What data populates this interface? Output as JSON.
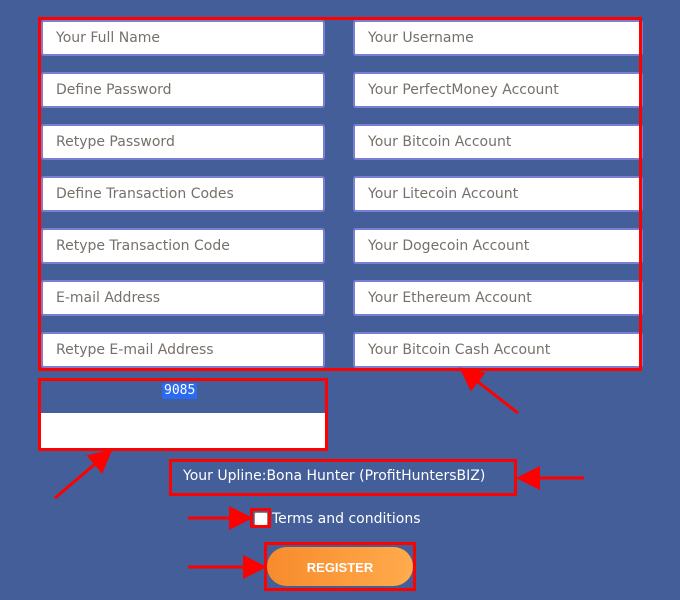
{
  "form": {
    "left_fields": [
      {
        "placeholder": "Your Full Name"
      },
      {
        "placeholder": "Define Password"
      },
      {
        "placeholder": "Retype Password"
      },
      {
        "placeholder": "Define Transaction Codes"
      },
      {
        "placeholder": "Retype Transaction Code"
      },
      {
        "placeholder": "E-mail Address"
      },
      {
        "placeholder": "Retype E-mail Address"
      }
    ],
    "right_fields": [
      {
        "placeholder": "Your Username"
      },
      {
        "placeholder": "Your PerfectMoney Account"
      },
      {
        "placeholder": "Your Bitcoin Account"
      },
      {
        "placeholder": "Your Litecoin Account"
      },
      {
        "placeholder": "Your Dogecoin Account"
      },
      {
        "placeholder": "Your Ethereum Account"
      },
      {
        "placeholder": "Your Bitcoin Cash Account"
      }
    ],
    "captcha_code": "9085",
    "captcha_value": "",
    "upline_text": "Your Upline:Bona Hunter (ProfitHuntersBIZ)",
    "terms_label": "Terms and conditions",
    "terms_checked": false,
    "register_label": "REGISTER"
  },
  "colors": {
    "background": "#435e98",
    "annotation": "#ff0000",
    "button_gradient_start": "#f78b2c",
    "button_gradient_end": "#ffab4c"
  }
}
